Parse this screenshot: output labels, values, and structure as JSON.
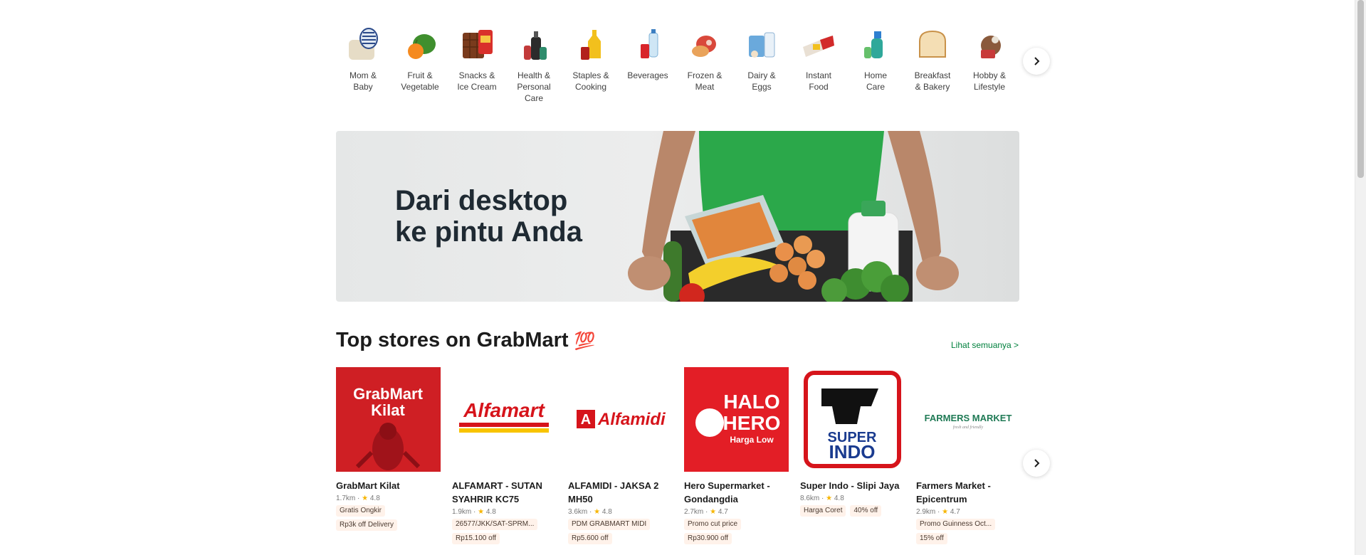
{
  "categories": [
    {
      "label": "Mom &\nBaby",
      "icon": "mom-baby-icon"
    },
    {
      "label": "Fruit &\nVegetable",
      "icon": "fruit-vegetable-icon"
    },
    {
      "label": "Snacks &\nIce Cream",
      "icon": "snacks-icon"
    },
    {
      "label": "Health &\nPersonal\nCare",
      "icon": "health-care-icon"
    },
    {
      "label": "Staples &\nCooking",
      "icon": "staples-icon"
    },
    {
      "label": "Beverages",
      "icon": "beverages-icon"
    },
    {
      "label": "Frozen &\nMeat",
      "icon": "frozen-meat-icon"
    },
    {
      "label": "Dairy &\nEggs",
      "icon": "dairy-eggs-icon"
    },
    {
      "label": "Instant\nFood",
      "icon": "instant-food-icon"
    },
    {
      "label": "Home\nCare",
      "icon": "home-care-icon"
    },
    {
      "label": "Breakfast\n& Bakery",
      "icon": "bakery-icon"
    },
    {
      "label": "Hobby &\nLifestyle",
      "icon": "hobby-icon"
    }
  ],
  "banner": {
    "text": "Dari desktop\nke pintu Anda"
  },
  "top_stores": {
    "title": "Top stores on GrabMart",
    "emoji": "💯",
    "see_all": "Lihat semuanya >",
    "stores": [
      {
        "name": "GrabMart Kilat",
        "distance": "1.7km",
        "rating": "4.8",
        "tags": [
          "Gratis Ongkir",
          "Rp3k off Delivery"
        ],
        "logo_text": "GrabMart\nKilat"
      },
      {
        "name": "ALFAMART - SUTAN SYAHRIR KC75",
        "distance": "1.9km",
        "rating": "4.8",
        "tags": [
          "26577/JKK/SAT-SPRM...",
          "Rp15.100 off"
        ],
        "logo_text": "Alfamart"
      },
      {
        "name": "ALFAMIDI - JAKSA 2 MH50",
        "distance": "3.6km",
        "rating": "4.8",
        "tags": [
          "PDM GRABMART MIDI",
          "Rp5.600 off"
        ],
        "logo_text": "Alfamidi"
      },
      {
        "name": "Hero Supermarket - Gondangdia",
        "distance": "2.7km",
        "rating": "4.7",
        "tags": [
          "Promo cut price",
          "Rp30.900 off"
        ],
        "logo_text": "HALO\nHERO"
      },
      {
        "name": "Super Indo - Slipi Jaya",
        "distance": "8.6km",
        "rating": "4.8",
        "tags": [
          "Harga Coret",
          "40% off"
        ],
        "logo_text": "SUPER\nINDO"
      },
      {
        "name": "Farmers Market - Epicentrum",
        "distance": "2.9km",
        "rating": "4.7",
        "tags": [
          "Promo Guinness Oct...",
          "15% off"
        ],
        "logo_text": "FARMERS MARKET"
      }
    ]
  },
  "colors": {
    "accent_green": "#00803d",
    "tag_bg": "#fff2ea",
    "star": "#f7b500"
  }
}
